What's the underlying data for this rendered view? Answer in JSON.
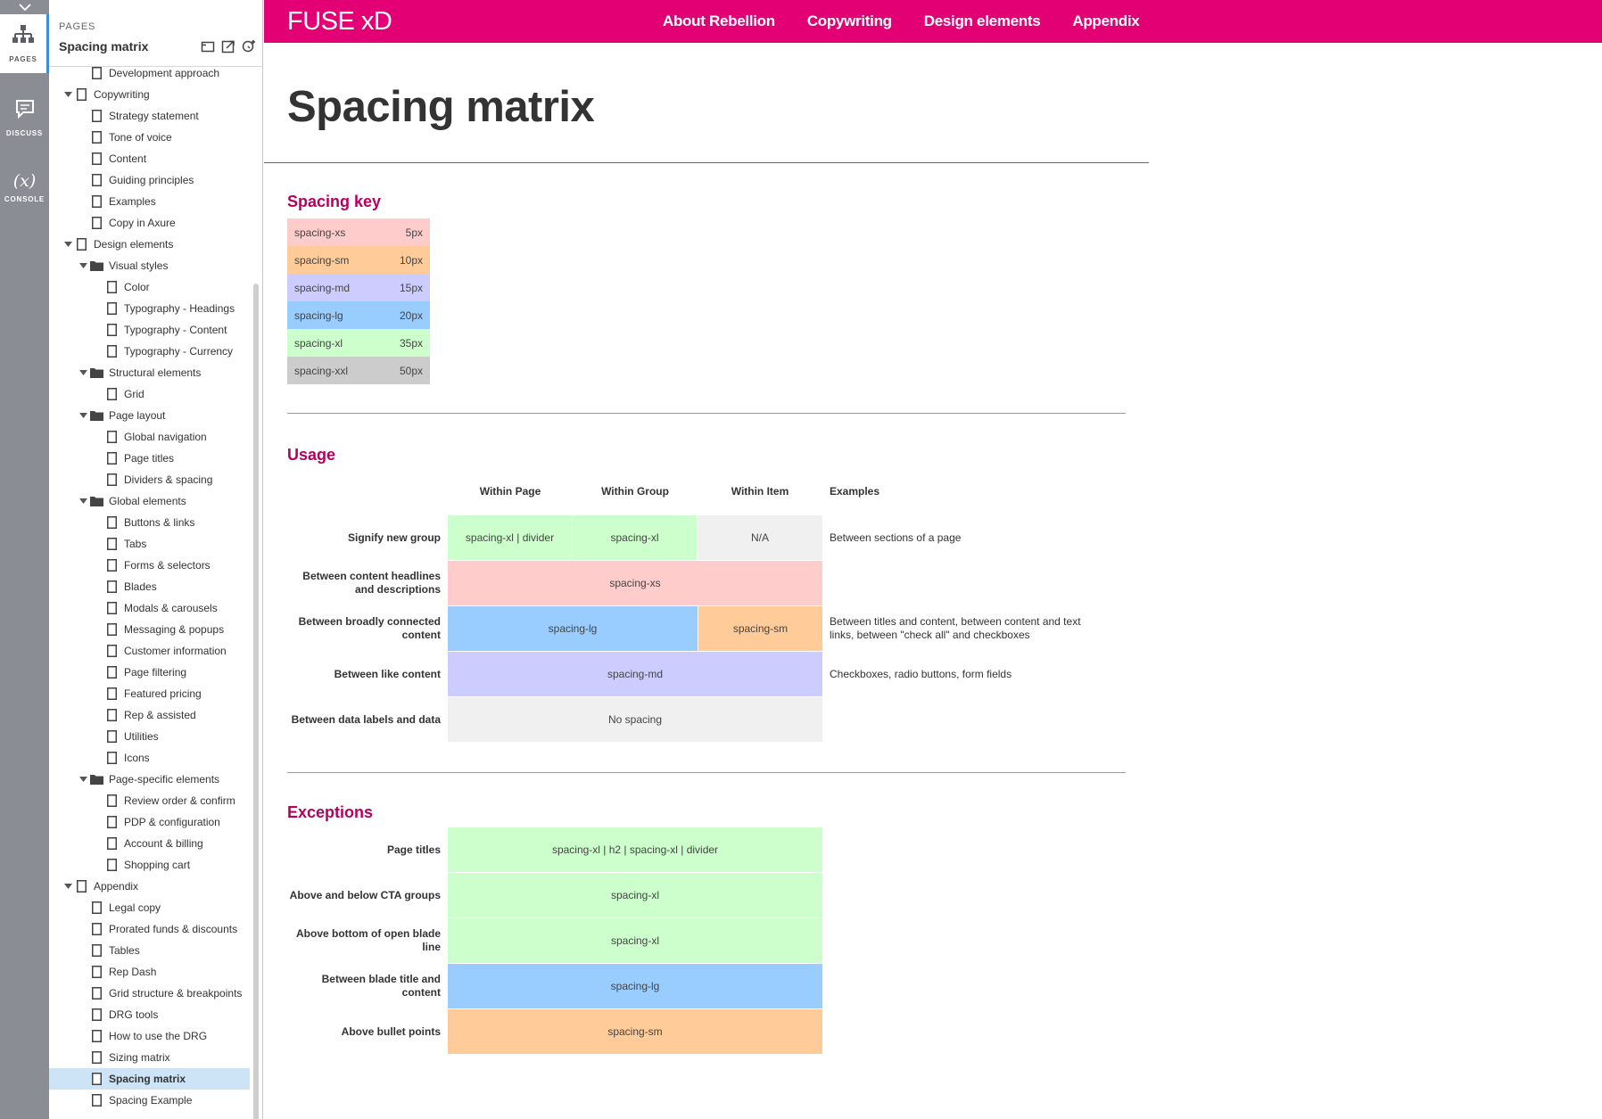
{
  "colors": {
    "brand": "#e20074",
    "heading": "#b5005f",
    "rail": "#8a8d93",
    "selected_row": "#cde3f6",
    "spacing_xs": "#ffcccc",
    "spacing_sm": "#ffcc99",
    "spacing_md": "#ccccff",
    "spacing_lg": "#99ccff",
    "spacing_xl": "#ccffcc",
    "spacing_xxl": "#cccccc",
    "none": "#f0f0f0"
  },
  "rail": {
    "pages_label": "PAGES",
    "discuss_label": "DISCUSS",
    "console_label": "CONSOLE",
    "console_glyph": "(x)"
  },
  "sidebar": {
    "caption": "PAGES",
    "title": "Spacing matrix",
    "tools": [
      "new-page-icon",
      "export-icon",
      "add-folder-icon"
    ],
    "items": [
      {
        "label": "Development approach",
        "level": 2,
        "type": "page"
      },
      {
        "label": "Copywriting",
        "level": 1,
        "type": "page",
        "expanded": true
      },
      {
        "label": "Strategy statement",
        "level": 2,
        "type": "page"
      },
      {
        "label": "Tone of voice",
        "level": 2,
        "type": "page"
      },
      {
        "label": "Content",
        "level": 2,
        "type": "page"
      },
      {
        "label": "Guiding principles",
        "level": 2,
        "type": "page"
      },
      {
        "label": "Examples",
        "level": 2,
        "type": "page"
      },
      {
        "label": "Copy in Axure",
        "level": 2,
        "type": "page"
      },
      {
        "label": "Design elements",
        "level": 1,
        "type": "page",
        "expanded": true
      },
      {
        "label": "Visual styles",
        "level": 2,
        "type": "folder",
        "expanded": true
      },
      {
        "label": "Color",
        "level": 3,
        "type": "page"
      },
      {
        "label": "Typography - Headings",
        "level": 3,
        "type": "page"
      },
      {
        "label": "Typography - Content",
        "level": 3,
        "type": "page"
      },
      {
        "label": "Typography - Currency",
        "level": 3,
        "type": "page"
      },
      {
        "label": "Structural elements",
        "level": 2,
        "type": "folder",
        "expanded": true
      },
      {
        "label": "Grid",
        "level": 3,
        "type": "page"
      },
      {
        "label": "Page layout",
        "level": 2,
        "type": "folder",
        "expanded": true
      },
      {
        "label": "Global navigation",
        "level": 3,
        "type": "page"
      },
      {
        "label": "Page titles",
        "level": 3,
        "type": "page"
      },
      {
        "label": "Dividers & spacing",
        "level": 3,
        "type": "page"
      },
      {
        "label": "Global elements",
        "level": 2,
        "type": "folder",
        "expanded": true
      },
      {
        "label": "Buttons & links",
        "level": 3,
        "type": "page"
      },
      {
        "label": "Tabs",
        "level": 3,
        "type": "page"
      },
      {
        "label": "Forms & selectors",
        "level": 3,
        "type": "page"
      },
      {
        "label": "Blades",
        "level": 3,
        "type": "page"
      },
      {
        "label": "Modals & carousels",
        "level": 3,
        "type": "page"
      },
      {
        "label": "Messaging & popups",
        "level": 3,
        "type": "page"
      },
      {
        "label": "Customer information",
        "level": 3,
        "type": "page"
      },
      {
        "label": "Page filtering",
        "level": 3,
        "type": "page"
      },
      {
        "label": "Featured pricing",
        "level": 3,
        "type": "page"
      },
      {
        "label": "Rep & assisted",
        "level": 3,
        "type": "page"
      },
      {
        "label": "Utilities",
        "level": 3,
        "type": "page"
      },
      {
        "label": "Icons",
        "level": 3,
        "type": "page"
      },
      {
        "label": "Page-specific elements",
        "level": 2,
        "type": "folder",
        "expanded": true
      },
      {
        "label": "Review order & confirm",
        "level": 3,
        "type": "page"
      },
      {
        "label": "PDP & configuration",
        "level": 3,
        "type": "page"
      },
      {
        "label": "Account & billing",
        "level": 3,
        "type": "page"
      },
      {
        "label": "Shopping cart",
        "level": 3,
        "type": "page"
      },
      {
        "label": "Appendix",
        "level": 1,
        "type": "page",
        "expanded": true
      },
      {
        "label": "Legal copy",
        "level": 2,
        "type": "page"
      },
      {
        "label": "Prorated funds & discounts",
        "level": 2,
        "type": "page"
      },
      {
        "label": "Tables",
        "level": 2,
        "type": "page"
      },
      {
        "label": "Rep Dash",
        "level": 2,
        "type": "page"
      },
      {
        "label": "Grid structure & breakpoints",
        "level": 2,
        "type": "page"
      },
      {
        "label": "DRG tools",
        "level": 2,
        "type": "page"
      },
      {
        "label": "How to use the DRG",
        "level": 2,
        "type": "page"
      },
      {
        "label": "Sizing matrix",
        "level": 2,
        "type": "page"
      },
      {
        "label": "Spacing matrix",
        "level": 2,
        "type": "page",
        "selected": true
      },
      {
        "label": "Spacing Example",
        "level": 2,
        "type": "page"
      }
    ]
  },
  "topbar": {
    "brand": "FUSE xD",
    "nav": [
      "About Rebellion",
      "Copywriting",
      "Design elements",
      "Appendix"
    ]
  },
  "page": {
    "title": "Spacing matrix",
    "spacing_key": {
      "heading": "Spacing key",
      "rows": [
        {
          "name": "spacing-xs",
          "value": "5px",
          "color": "#ffcccc"
        },
        {
          "name": "spacing-sm",
          "value": "10px",
          "color": "#ffcc99"
        },
        {
          "name": "spacing-md",
          "value": "15px",
          "color": "#ccccff"
        },
        {
          "name": "spacing-lg",
          "value": "20px",
          "color": "#99ccff"
        },
        {
          "name": "spacing-xl",
          "value": "35px",
          "color": "#ccffcc"
        },
        {
          "name": "spacing-xxl",
          "value": "50px",
          "color": "#cccccc"
        }
      ]
    },
    "usage": {
      "heading": "Usage",
      "columns": [
        "Within Page",
        "Within Group",
        "Within Item",
        "Examples"
      ],
      "rows": [
        {
          "label": "Signify new group",
          "cells": [
            "spacing-xl | divider",
            "spacing-xl",
            "N/A"
          ],
          "example": "Between sections of a page"
        },
        {
          "label": "Between content headlines and descriptions",
          "cells": [
            "spacing-xs"
          ],
          "example": ""
        },
        {
          "label": "Between broadly connected content",
          "cells": [
            "spacing-lg",
            "spacing-sm"
          ],
          "example": "Between titles and content, between content and text links, between \"check all\" and checkboxes"
        },
        {
          "label": "Between like content",
          "cells": [
            "spacing-md"
          ],
          "example": "Checkboxes, radio buttons, form fields"
        },
        {
          "label": "Between data labels and data",
          "cells": [
            "No spacing"
          ],
          "example": ""
        }
      ]
    },
    "exceptions": {
      "heading": "Exceptions",
      "rows": [
        {
          "label": "Page titles",
          "value": "spacing-xl | h2 | spacing-xl | divider"
        },
        {
          "label": "Above and below CTA groups",
          "value": "spacing-xl"
        },
        {
          "label": "Above bottom of open blade line",
          "value": "spacing-xl"
        },
        {
          "label": "Between blade title and content",
          "value": "spacing-lg"
        },
        {
          "label": "Above bullet points",
          "value": "spacing-sm"
        }
      ]
    }
  }
}
